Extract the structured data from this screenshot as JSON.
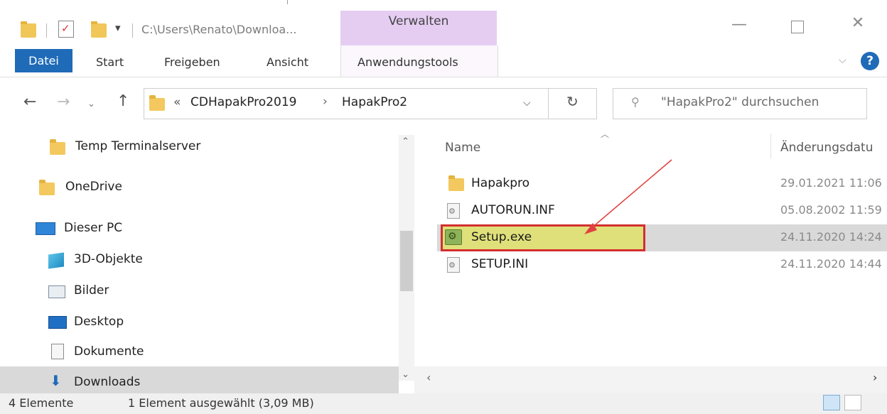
{
  "window": {
    "title_path": "C:\\Users\\Renato\\Downloa...",
    "context_tab": "Verwalten"
  },
  "ribbon": {
    "tabs": [
      "Datei",
      "Start",
      "Freigeben",
      "Ansicht",
      "Anwendungstools"
    ],
    "help_glyph": "?"
  },
  "address": {
    "overflow_glyph": "«",
    "crumbs": [
      "CDHapakPro2019",
      "HapakPro2"
    ],
    "search_placeholder": "\"HapakPro2\" durchsuchen"
  },
  "nav_pane": {
    "items": [
      {
        "label": "Temp Terminalserver",
        "icon": "folder-icon"
      },
      {
        "label": "OneDrive",
        "icon": "folder-icon"
      },
      {
        "label": "Dieser PC",
        "icon": "pc-icon"
      },
      {
        "label": "3D-Objekte",
        "icon": "cube-icon"
      },
      {
        "label": "Bilder",
        "icon": "pictures-icon"
      },
      {
        "label": "Desktop",
        "icon": "desktop-icon"
      },
      {
        "label": "Dokumente",
        "icon": "document-icon"
      },
      {
        "label": "Downloads",
        "icon": "download-icon"
      }
    ]
  },
  "file_list": {
    "columns": [
      "Name",
      "Änderungsdatu"
    ],
    "rows": [
      {
        "name": "Hapakpro",
        "date": "29.01.2021 11:06",
        "icon": "folder-icon"
      },
      {
        "name": "AUTORUN.INF",
        "date": "05.08.2002 11:59",
        "icon": "settings-file-icon"
      },
      {
        "name": "Setup.exe",
        "date": "24.11.2020 14:24",
        "icon": "installer-icon",
        "selected": true
      },
      {
        "name": "SETUP.INI",
        "date": "24.11.2020 14:44",
        "icon": "settings-file-icon"
      }
    ]
  },
  "status": {
    "count": "4 Elemente",
    "selection": "1 Element ausgewählt (3,09 MB)"
  },
  "colors": {
    "accent": "#1f6bb8",
    "context_tab": "#e5cdf2",
    "highlight_fill": "#dfe07a",
    "highlight_border": "#d32f2f",
    "arrow": "#e04040"
  }
}
